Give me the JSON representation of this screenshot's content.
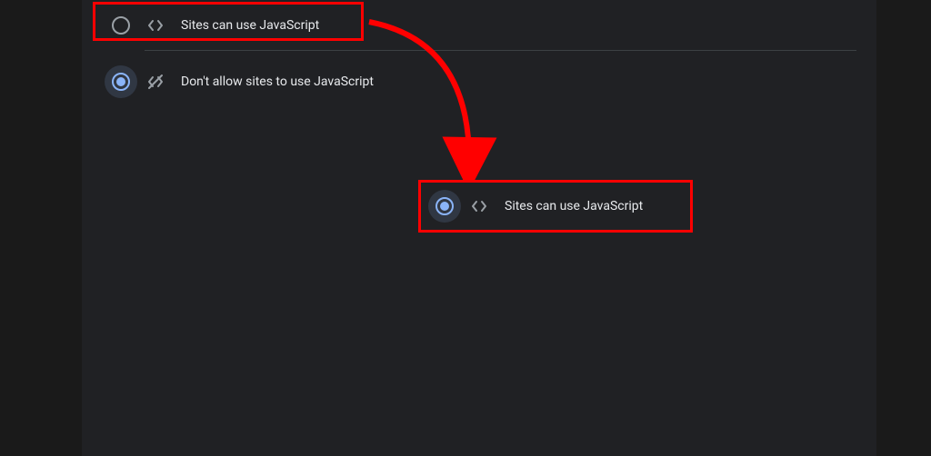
{
  "settings": {
    "options": [
      {
        "label": "Sites can use JavaScript",
        "selected": false
      },
      {
        "label": "Don't allow sites to use JavaScript",
        "selected": true
      }
    ]
  },
  "callout": {
    "label": "Sites can use JavaScript"
  }
}
